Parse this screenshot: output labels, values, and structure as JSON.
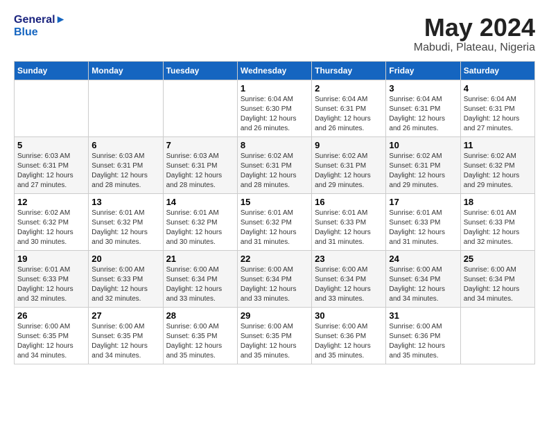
{
  "logo": {
    "line1": "General",
    "line2": "Blue"
  },
  "title": "May 2024",
  "subtitle": "Mabudi, Plateau, Nigeria",
  "weekdays": [
    "Sunday",
    "Monday",
    "Tuesday",
    "Wednesday",
    "Thursday",
    "Friday",
    "Saturday"
  ],
  "weeks": [
    [
      {
        "day": "",
        "sunrise": "",
        "sunset": "",
        "daylight": ""
      },
      {
        "day": "",
        "sunrise": "",
        "sunset": "",
        "daylight": ""
      },
      {
        "day": "",
        "sunrise": "",
        "sunset": "",
        "daylight": ""
      },
      {
        "day": "1",
        "sunrise": "Sunrise: 6:04 AM",
        "sunset": "Sunset: 6:30 PM",
        "daylight": "Daylight: 12 hours and 26 minutes."
      },
      {
        "day": "2",
        "sunrise": "Sunrise: 6:04 AM",
        "sunset": "Sunset: 6:31 PM",
        "daylight": "Daylight: 12 hours and 26 minutes."
      },
      {
        "day": "3",
        "sunrise": "Sunrise: 6:04 AM",
        "sunset": "Sunset: 6:31 PM",
        "daylight": "Daylight: 12 hours and 26 minutes."
      },
      {
        "day": "4",
        "sunrise": "Sunrise: 6:04 AM",
        "sunset": "Sunset: 6:31 PM",
        "daylight": "Daylight: 12 hours and 27 minutes."
      }
    ],
    [
      {
        "day": "5",
        "sunrise": "Sunrise: 6:03 AM",
        "sunset": "Sunset: 6:31 PM",
        "daylight": "Daylight: 12 hours and 27 minutes."
      },
      {
        "day": "6",
        "sunrise": "Sunrise: 6:03 AM",
        "sunset": "Sunset: 6:31 PM",
        "daylight": "Daylight: 12 hours and 28 minutes."
      },
      {
        "day": "7",
        "sunrise": "Sunrise: 6:03 AM",
        "sunset": "Sunset: 6:31 PM",
        "daylight": "Daylight: 12 hours and 28 minutes."
      },
      {
        "day": "8",
        "sunrise": "Sunrise: 6:02 AM",
        "sunset": "Sunset: 6:31 PM",
        "daylight": "Daylight: 12 hours and 28 minutes."
      },
      {
        "day": "9",
        "sunrise": "Sunrise: 6:02 AM",
        "sunset": "Sunset: 6:31 PM",
        "daylight": "Daylight: 12 hours and 29 minutes."
      },
      {
        "day": "10",
        "sunrise": "Sunrise: 6:02 AM",
        "sunset": "Sunset: 6:31 PM",
        "daylight": "Daylight: 12 hours and 29 minutes."
      },
      {
        "day": "11",
        "sunrise": "Sunrise: 6:02 AM",
        "sunset": "Sunset: 6:32 PM",
        "daylight": "Daylight: 12 hours and 29 minutes."
      }
    ],
    [
      {
        "day": "12",
        "sunrise": "Sunrise: 6:02 AM",
        "sunset": "Sunset: 6:32 PM",
        "daylight": "Daylight: 12 hours and 30 minutes."
      },
      {
        "day": "13",
        "sunrise": "Sunrise: 6:01 AM",
        "sunset": "Sunset: 6:32 PM",
        "daylight": "Daylight: 12 hours and 30 minutes."
      },
      {
        "day": "14",
        "sunrise": "Sunrise: 6:01 AM",
        "sunset": "Sunset: 6:32 PM",
        "daylight": "Daylight: 12 hours and 30 minutes."
      },
      {
        "day": "15",
        "sunrise": "Sunrise: 6:01 AM",
        "sunset": "Sunset: 6:32 PM",
        "daylight": "Daylight: 12 hours and 31 minutes."
      },
      {
        "day": "16",
        "sunrise": "Sunrise: 6:01 AM",
        "sunset": "Sunset: 6:33 PM",
        "daylight": "Daylight: 12 hours and 31 minutes."
      },
      {
        "day": "17",
        "sunrise": "Sunrise: 6:01 AM",
        "sunset": "Sunset: 6:33 PM",
        "daylight": "Daylight: 12 hours and 31 minutes."
      },
      {
        "day": "18",
        "sunrise": "Sunrise: 6:01 AM",
        "sunset": "Sunset: 6:33 PM",
        "daylight": "Daylight: 12 hours and 32 minutes."
      }
    ],
    [
      {
        "day": "19",
        "sunrise": "Sunrise: 6:01 AM",
        "sunset": "Sunset: 6:33 PM",
        "daylight": "Daylight: 12 hours and 32 minutes."
      },
      {
        "day": "20",
        "sunrise": "Sunrise: 6:00 AM",
        "sunset": "Sunset: 6:33 PM",
        "daylight": "Daylight: 12 hours and 32 minutes."
      },
      {
        "day": "21",
        "sunrise": "Sunrise: 6:00 AM",
        "sunset": "Sunset: 6:34 PM",
        "daylight": "Daylight: 12 hours and 33 minutes."
      },
      {
        "day": "22",
        "sunrise": "Sunrise: 6:00 AM",
        "sunset": "Sunset: 6:34 PM",
        "daylight": "Daylight: 12 hours and 33 minutes."
      },
      {
        "day": "23",
        "sunrise": "Sunrise: 6:00 AM",
        "sunset": "Sunset: 6:34 PM",
        "daylight": "Daylight: 12 hours and 33 minutes."
      },
      {
        "day": "24",
        "sunrise": "Sunrise: 6:00 AM",
        "sunset": "Sunset: 6:34 PM",
        "daylight": "Daylight: 12 hours and 34 minutes."
      },
      {
        "day": "25",
        "sunrise": "Sunrise: 6:00 AM",
        "sunset": "Sunset: 6:34 PM",
        "daylight": "Daylight: 12 hours and 34 minutes."
      }
    ],
    [
      {
        "day": "26",
        "sunrise": "Sunrise: 6:00 AM",
        "sunset": "Sunset: 6:35 PM",
        "daylight": "Daylight: 12 hours and 34 minutes."
      },
      {
        "day": "27",
        "sunrise": "Sunrise: 6:00 AM",
        "sunset": "Sunset: 6:35 PM",
        "daylight": "Daylight: 12 hours and 34 minutes."
      },
      {
        "day": "28",
        "sunrise": "Sunrise: 6:00 AM",
        "sunset": "Sunset: 6:35 PM",
        "daylight": "Daylight: 12 hours and 35 minutes."
      },
      {
        "day": "29",
        "sunrise": "Sunrise: 6:00 AM",
        "sunset": "Sunset: 6:35 PM",
        "daylight": "Daylight: 12 hours and 35 minutes."
      },
      {
        "day": "30",
        "sunrise": "Sunrise: 6:00 AM",
        "sunset": "Sunset: 6:36 PM",
        "daylight": "Daylight: 12 hours and 35 minutes."
      },
      {
        "day": "31",
        "sunrise": "Sunrise: 6:00 AM",
        "sunset": "Sunset: 6:36 PM",
        "daylight": "Daylight: 12 hours and 35 minutes."
      },
      {
        "day": "",
        "sunrise": "",
        "sunset": "",
        "daylight": ""
      }
    ]
  ]
}
